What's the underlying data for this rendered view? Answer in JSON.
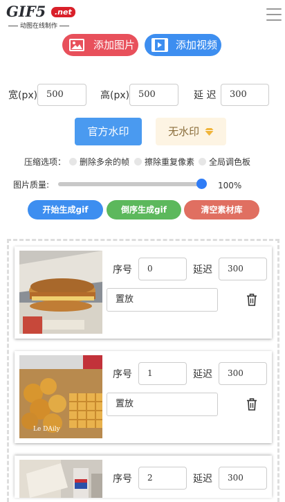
{
  "header": {
    "logo_main": "GIF5",
    "logo_badge": ".net",
    "logo_sub": "动图在线制作"
  },
  "buttons": {
    "add_image": "添加图片",
    "add_video": "添加视频"
  },
  "size": {
    "width_label": "宽(px)",
    "width_value": "500",
    "height_label": "高(px)",
    "height_value": "500",
    "delay_label": "延 迟",
    "delay_value": "300"
  },
  "watermark": {
    "official": "官方水印",
    "none": "无水印"
  },
  "compress": {
    "label": "压缩选项：",
    "options": [
      "删除多余的帧",
      "擦除重复像素",
      "全局调色板"
    ]
  },
  "quality": {
    "label": "图片质量:",
    "value_text": "100%",
    "level": 1.0
  },
  "actions": {
    "generate": "开始生成gif",
    "reverse": "倒序生成gif",
    "clear": "清空素材库"
  },
  "frames": [
    {
      "index_label": "序号",
      "index": "0",
      "delay_label": "延迟",
      "delay": "300",
      "mode": "置放"
    },
    {
      "index_label": "序号",
      "index": "1",
      "delay_label": "延迟",
      "delay": "300",
      "mode": "置放",
      "caption": "Le DAily"
    },
    {
      "index_label": "序号",
      "index": "2",
      "delay_label": "延迟",
      "delay": "300"
    }
  ],
  "colors": {
    "red": "#e8505b",
    "blue": "#3d8ef0",
    "green": "#5cb85c",
    "salmon": "#e06f61",
    "wm_blue": "#4a9af0",
    "wm_gold": "#fdf4e3",
    "slider": "#2f7cf6"
  }
}
